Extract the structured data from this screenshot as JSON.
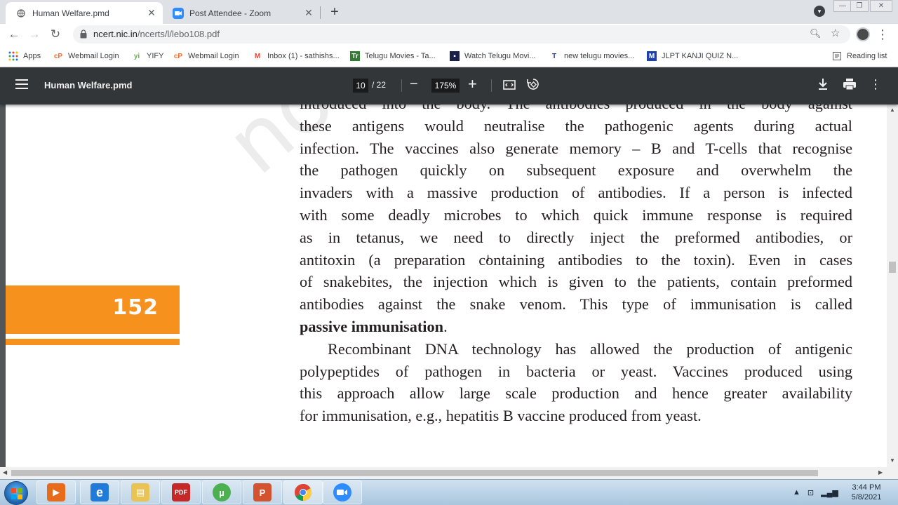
{
  "browser": {
    "tabs": [
      {
        "title": "Human Welfare.pmd",
        "active": true,
        "icon": "globe-icon"
      },
      {
        "title": "Post Attendee - Zoom",
        "active": false,
        "icon": "zoom-icon"
      }
    ],
    "new_tab_label": "+",
    "url_host": "ncert.nic.in",
    "url_path": "/ncerts/l/lebo108.pdf",
    "bookmarks": [
      {
        "label": "Apps",
        "icon": "apps-grid-icon"
      },
      {
        "label": "Webmail Login",
        "icon": "cp-icon"
      },
      {
        "label": "YIFY",
        "icon": "yify-icon"
      },
      {
        "label": "Webmail Login",
        "icon": "cp-icon"
      },
      {
        "label": "Inbox (1) - sathishs...",
        "icon": "gmail-icon"
      },
      {
        "label": "Telugu Movies - Ta...",
        "icon": "tr-icon"
      },
      {
        "label": "Watch Telugu Movi...",
        "icon": "movie-icon"
      },
      {
        "label": "new telugu movies...",
        "icon": "t-icon"
      },
      {
        "label": "JLPT KANJI QUIZ N...",
        "icon": "m-icon"
      }
    ],
    "reading_list_label": "Reading list"
  },
  "pdf_viewer": {
    "title": "Human Welfare.pmd",
    "current_page": "10",
    "total_pages": "/ 22",
    "zoom": "175%"
  },
  "document": {
    "watermark": "not to be",
    "page_number": "152",
    "lines": [
      {
        "text": "introduced into the body. The antibodies produced in the body against"
      },
      {
        "text": "these antigens would neutralise the pathogenic agents during actual"
      },
      {
        "text": "infection. The vaccines also generate memory – B and T-cells that recognise"
      },
      {
        "text": "the pathogen quickly on subsequent exposure and overwhelm the"
      },
      {
        "text": "invaders with a massive production of antibodies. If a person is infected"
      },
      {
        "text": "with some deadly microbes to which quick immune response is required"
      },
      {
        "text": "as in tetanus, we need to directly inject the preformed antibodies, or"
      },
      {
        "text": "antitoxin (a preparation containing antibodies to the toxin). Even in cases"
      },
      {
        "text": "of snakebites, the injection which is given to the patients, contain preformed"
      },
      {
        "text": "antibodies against the snake venom. This type of immunisation is called"
      }
    ],
    "bold_term": "passive immunisation",
    "bold_term_suffix": ".",
    "para2_lines": [
      {
        "text": "Recombinant DNA technology has allowed the production of antigenic"
      },
      {
        "text": "polypeptides of pathogen in bacteria or yeast. Vaccines produced using"
      },
      {
        "text": "this approach allow large scale production and hence greater availability"
      },
      {
        "text": "for immunisation, e.g., hepatitis B vaccine produced from yeast."
      }
    ]
  },
  "taskbar": {
    "time": "3:44 PM",
    "date": "5/8/2021",
    "apps": [
      {
        "name": "media-player-icon"
      },
      {
        "name": "internet-explorer-icon"
      },
      {
        "name": "file-explorer-icon"
      },
      {
        "name": "pdf-reader-icon"
      },
      {
        "name": "utorrent-icon"
      },
      {
        "name": "powerpoint-icon"
      },
      {
        "name": "chrome-icon"
      },
      {
        "name": "zoom-app-icon"
      }
    ]
  },
  "colors": {
    "accent_orange": "#f6911e",
    "pdf_toolbar": "#323639",
    "viewer_bg": "#525659"
  }
}
